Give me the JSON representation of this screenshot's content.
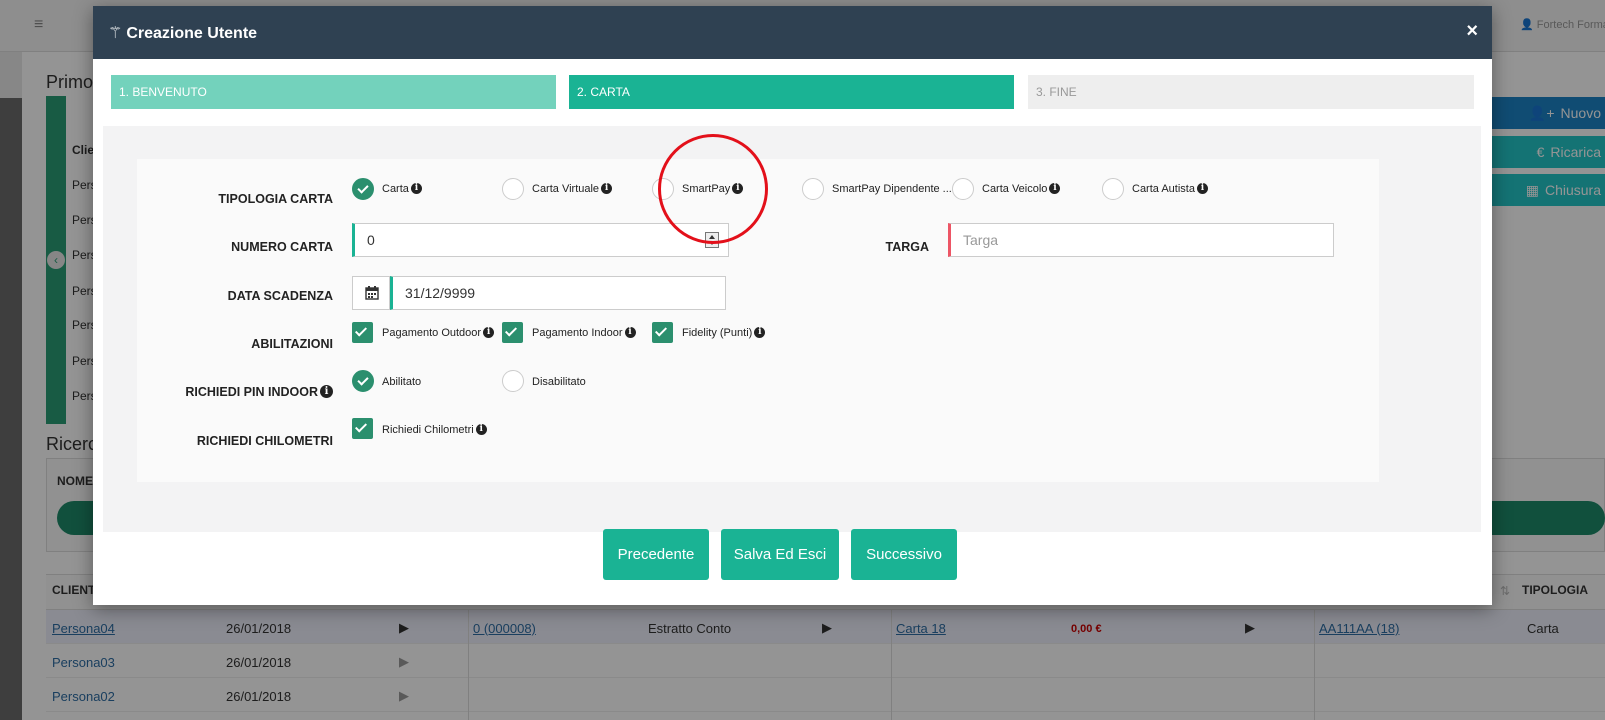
{
  "app": {
    "user_label": "Fortech Forma",
    "section_title_1": "Primo",
    "section_title_2": "Ricerc",
    "table1_header": "Clie",
    "table1_rows": [
      "Pers",
      "Pers",
      "Pers",
      "Pers",
      "Pers",
      "Pers",
      "Pers"
    ],
    "filter_label": "NOME",
    "side_buttons": [
      {
        "label": "Nuovo",
        "color": "#1c84c6"
      },
      {
        "label": "Ricarica",
        "color": "#23c6c8"
      },
      {
        "label": "Chiusura",
        "color": "#23c6c8"
      }
    ],
    "table2_headers": {
      "client": "CLIENT",
      "tipologia": "TIPOLOGIA"
    },
    "table2_rows": [
      {
        "name": "Persona04",
        "date": "26/01/2018"
      },
      {
        "name": "Persona03",
        "date": "26/01/2018"
      },
      {
        "name": "Persona02",
        "date": "26/01/2018"
      }
    ],
    "row1_cells": {
      "account": "0 (000008)",
      "type": "Estratto Conto",
      "card": "Carta 18",
      "amount": "0,00 €",
      "plate": "AA111AA (18)",
      "tipologia": "Carta"
    }
  },
  "modal": {
    "title": "Creazione Utente",
    "close_symbol": "×",
    "steps": [
      {
        "label": "1. BENVENUTO"
      },
      {
        "label": "2. CARTA"
      },
      {
        "label": "3. FINE"
      }
    ],
    "labels": {
      "tipologia": "TIPOLOGIA CARTA",
      "numero": "NUMERO CARTA",
      "targa": "TARGA",
      "scadenza": "DATA SCADENZA",
      "abilitazioni": "ABILITAZIONI",
      "pin": "RICHIEDI PIN INDOOR",
      "chilometri": "RICHIEDI CHILOMETRI"
    },
    "tipologia_options": [
      {
        "label": "Carta",
        "selected": true
      },
      {
        "label": "Carta Virtuale",
        "selected": false
      },
      {
        "label": "SmartPay",
        "selected": false
      },
      {
        "label": "SmartPay Dipendente ...",
        "selected": false
      },
      {
        "label": "Carta Veicolo",
        "selected": false
      },
      {
        "label": "Carta Autista",
        "selected": false
      }
    ],
    "numero_value": "0",
    "targa_placeholder": "Targa",
    "scadenza_value": "31/12/9999",
    "abilitazioni": [
      {
        "label": "Pagamento Outdoor",
        "checked": true
      },
      {
        "label": "Pagamento Indoor",
        "checked": true
      },
      {
        "label": "Fidelity (Punti)",
        "checked": true
      }
    ],
    "pin_options": [
      {
        "label": "Abilitato",
        "selected": true
      },
      {
        "label": "Disabilitato",
        "selected": false
      }
    ],
    "chilometri_option": {
      "label": "Richiedi Chilometri",
      "checked": true
    },
    "buttons": {
      "prev": "Precedente",
      "save": "Salva Ed Esci",
      "next": "Successivo"
    },
    "accent_color": "#1ab394",
    "header_color": "#2f4152",
    "highlight_color": "#e3101a"
  }
}
